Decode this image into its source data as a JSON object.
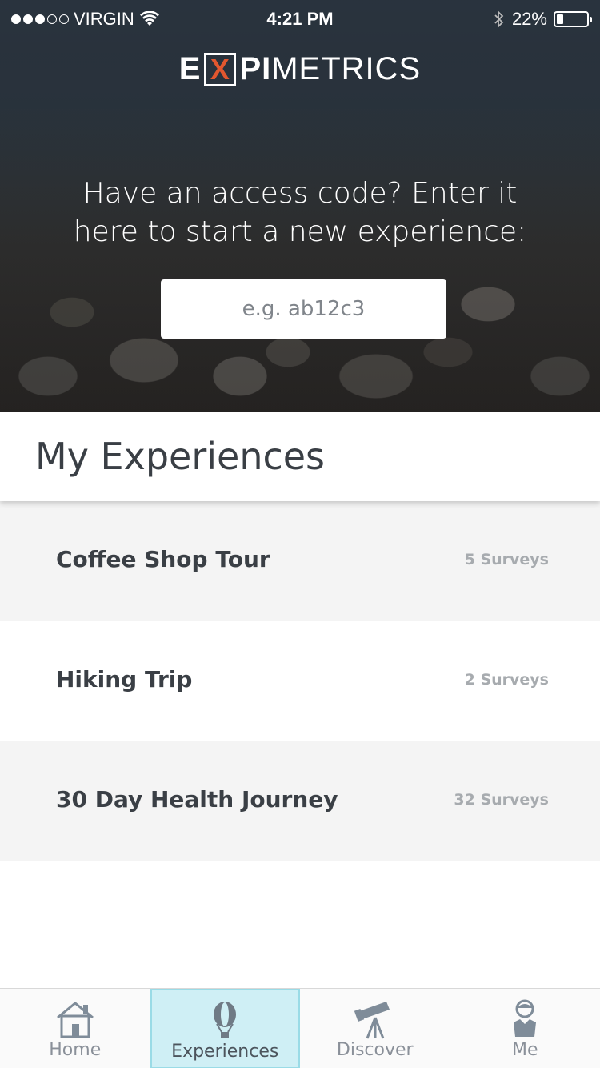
{
  "status_bar": {
    "carrier": "VIRGIN",
    "signal_dots_filled": 3,
    "signal_dots_total": 5,
    "time": "4:21 PM",
    "battery_percent_text": "22%",
    "battery_level": 0.22,
    "icons": [
      "wifi-icon",
      "bluetooth-icon",
      "battery-icon"
    ]
  },
  "brand": {
    "logo_e": "E",
    "logo_x": "X",
    "logo_pi": "PI",
    "logo_metrics": "METRICS",
    "accent_color": "#e2572f"
  },
  "access": {
    "prompt_line1": "Have an access code? Enter it",
    "prompt_line2": "here to start a new experience:",
    "placeholder": "e.g. ab12c3"
  },
  "experiences": {
    "heading": "My Experiences",
    "items": [
      {
        "title": "Coffee Shop Tour",
        "count": "5 Surveys"
      },
      {
        "title": "Hiking Trip",
        "count": "2 Surveys"
      },
      {
        "title": "30 Day Health Journey",
        "count": "32 Surveys"
      }
    ]
  },
  "tabs": [
    {
      "label": "Home",
      "icon": "home-icon",
      "active": false
    },
    {
      "label": "Experiences",
      "icon": "balloon-icon",
      "active": true
    },
    {
      "label": "Discover",
      "icon": "telescope-icon",
      "active": false
    },
    {
      "label": "Me",
      "icon": "person-icon",
      "active": false
    }
  ],
  "colors": {
    "active_tab_bg": "#cfeff5",
    "icon_color": "#7f8c99"
  }
}
